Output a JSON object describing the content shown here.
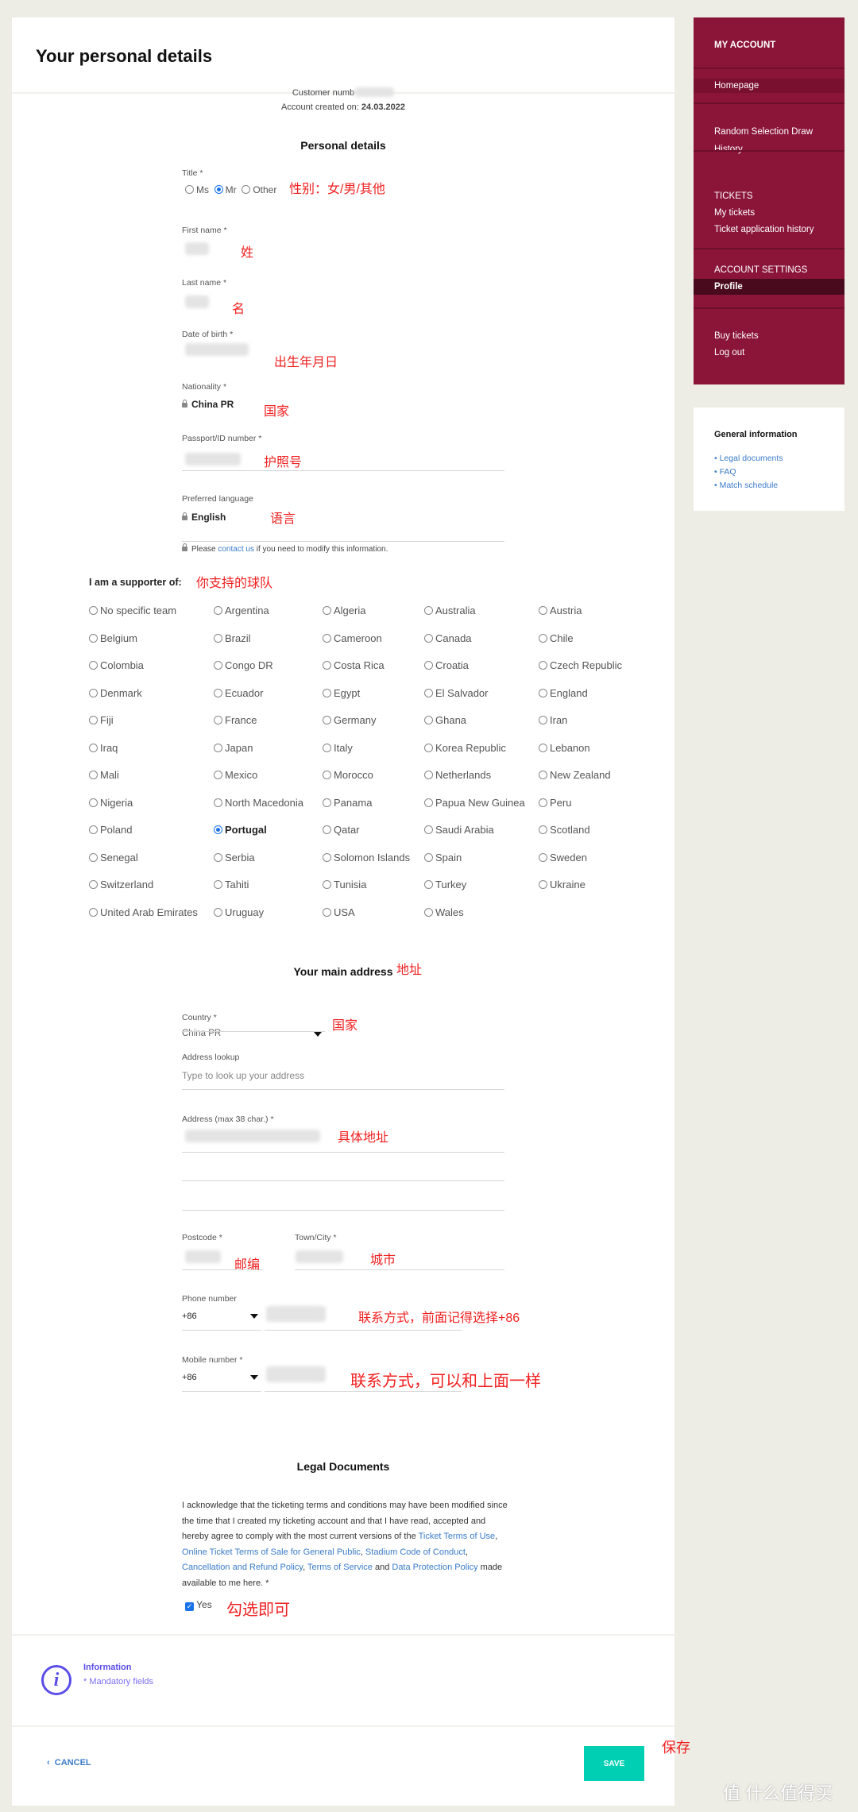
{
  "header": {
    "title": "Your personal details"
  },
  "account": {
    "customer_label": "Customer numb",
    "created_label": "Account created on:",
    "created_date": "24.03.2022"
  },
  "personal": {
    "heading": "Personal details",
    "title_label": "Title *",
    "title_options": [
      "Ms",
      "Mr",
      "Other"
    ],
    "title_selected": "Mr",
    "first_name_label": "First name *",
    "last_name_label": "Last name *",
    "dob_label": "Date of birth *",
    "nationality_label": "Nationality *",
    "nationality_value": "China PR",
    "passport_label": "Passport/ID number *",
    "language_label": "Preferred language",
    "language_value": "English",
    "note_pre": "Please ",
    "note_link": "contact us",
    "note_post": " if you need to modify this information."
  },
  "supporter": {
    "heading": "I am a supporter of:",
    "selected": "Portugal",
    "teams": [
      "No specific team",
      "Argentina",
      "Algeria",
      "Australia",
      "Austria",
      "Belgium",
      "Brazil",
      "Cameroon",
      "Canada",
      "Chile",
      "Colombia",
      "Congo DR",
      "Costa Rica",
      "Croatia",
      "Czech Republic",
      "Denmark",
      "Ecuador",
      "Egypt",
      "El Salvador",
      "England",
      "Fiji",
      "France",
      "Germany",
      "Ghana",
      "Iran",
      "Iraq",
      "Japan",
      "Italy",
      "Korea Republic",
      "Lebanon",
      "Mali",
      "Mexico",
      "Morocco",
      "Netherlands",
      "New Zealand",
      "Nigeria",
      "North Macedonia",
      "Panama",
      "Papua New Guinea",
      "Peru",
      "Poland",
      "Portugal",
      "Qatar",
      "Saudi Arabia",
      "Scotland",
      "Senegal",
      "Serbia",
      "Solomon Islands",
      "Spain",
      "Sweden",
      "Switzerland",
      "Tahiti",
      "Tunisia",
      "Turkey",
      "Ukraine",
      "United Arab Emirates",
      "Uruguay",
      "USA",
      "Wales"
    ]
  },
  "address": {
    "heading": "Your main address",
    "country_label": "Country *",
    "country_value": "China PR",
    "lookup_label": "Address lookup",
    "lookup_placeholder": "Type to look up your address",
    "address_label": "Address  (max 38 char.) *",
    "postcode_label": "Postcode *",
    "town_label": "Town/City *",
    "phone_label": "Phone number",
    "phone_code": "+86",
    "mobile_label": "Mobile number *",
    "mobile_code": "+86"
  },
  "legal": {
    "heading": "Legal Documents",
    "t1": "I acknowledge that the ticketing terms and conditions may have been modified since the time that I created my ticketing account and that I have read, accepted and hereby agree to comply with the most current versions of the ",
    "l1": "Ticket Terms of Use",
    "s1": ", ",
    "l2": "Online Ticket Terms of Sale for General Public",
    "s2": ", ",
    "l3": "Stadium Code of Conduct",
    "s3": ", ",
    "l4": "Cancellation and Refund Policy",
    "s4": ", ",
    "l5": "Terms of Service",
    "s5": " and ",
    "l6": "Data Protection Policy",
    "t2": " made available to me here.  *",
    "yes_label": "Yes",
    "yes_checked": true
  },
  "info": {
    "title": "Information",
    "text": "* Mandatory fields"
  },
  "footer": {
    "cancel": "CANCEL",
    "save": "SAVE"
  },
  "sidebar": {
    "heading": "MY ACCOUNT",
    "homepage": "Homepage",
    "draw1": "Random Selection Draw",
    "draw2": "History",
    "tickets": "TICKETS",
    "my_tickets": "My tickets",
    "ticket_history": "Ticket application history",
    "settings": "ACCOUNT SETTINGS",
    "profile": "Profile",
    "buy": "Buy tickets",
    "logout": "Log out"
  },
  "general": {
    "heading": "General information",
    "links": [
      "Legal documents",
      "FAQ",
      "Match schedule"
    ]
  },
  "annotations": {
    "title": "性别：女/男/其他",
    "first": "姓",
    "last": "名",
    "dob": "出生年月日",
    "nat": "国家",
    "passport": "护照号",
    "lang": "语言",
    "team": "你支持的球队",
    "addr_head": "地址",
    "country": "国家",
    "address": "具体地址",
    "postcode": "邮编",
    "town": "城市",
    "phone": "联系方式，前面记得选择+86",
    "mobile": "联系方式，可以和上面一样",
    "check": "勾选即可",
    "save": "保存"
  },
  "watermark": "值 什么值得买",
  "colors": {
    "sidebar": "#8a1538",
    "active": "#4a0a1e",
    "save": "#00cfb4",
    "link": "#3a7bc8",
    "info": "#5b4ee8",
    "annotation": "#f02020"
  }
}
